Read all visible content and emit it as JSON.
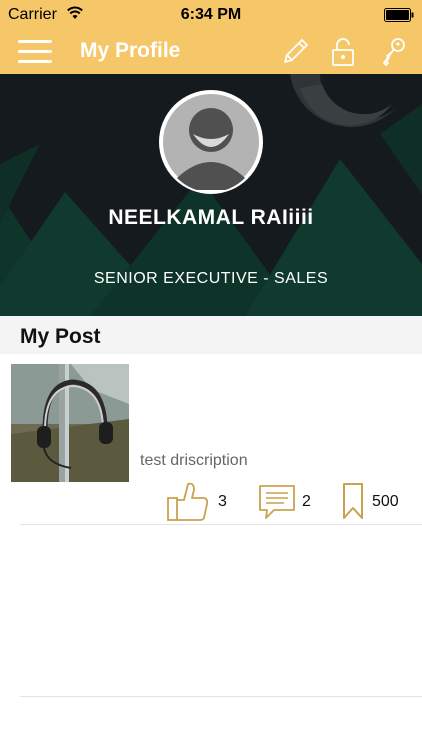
{
  "status_bar": {
    "carrier": "Carrier",
    "time": "6:34 PM"
  },
  "nav": {
    "title": "My Profile",
    "icons": [
      "menu-icon",
      "pencil-icon",
      "unlock-icon",
      "key-icon"
    ]
  },
  "profile": {
    "name": "NEELKAMAL RAIiiii",
    "role": "SENIOR EXECUTIVE - SALES"
  },
  "section": {
    "title": "My Post"
  },
  "post": {
    "description": "test driscription",
    "likes": "3",
    "comments": "2",
    "bookmarks": "500"
  },
  "colors": {
    "accent": "#F6C768",
    "icon_gold": "#C9A24E",
    "header_dark": "#141a1e",
    "mountain_green": "#0f3429"
  }
}
